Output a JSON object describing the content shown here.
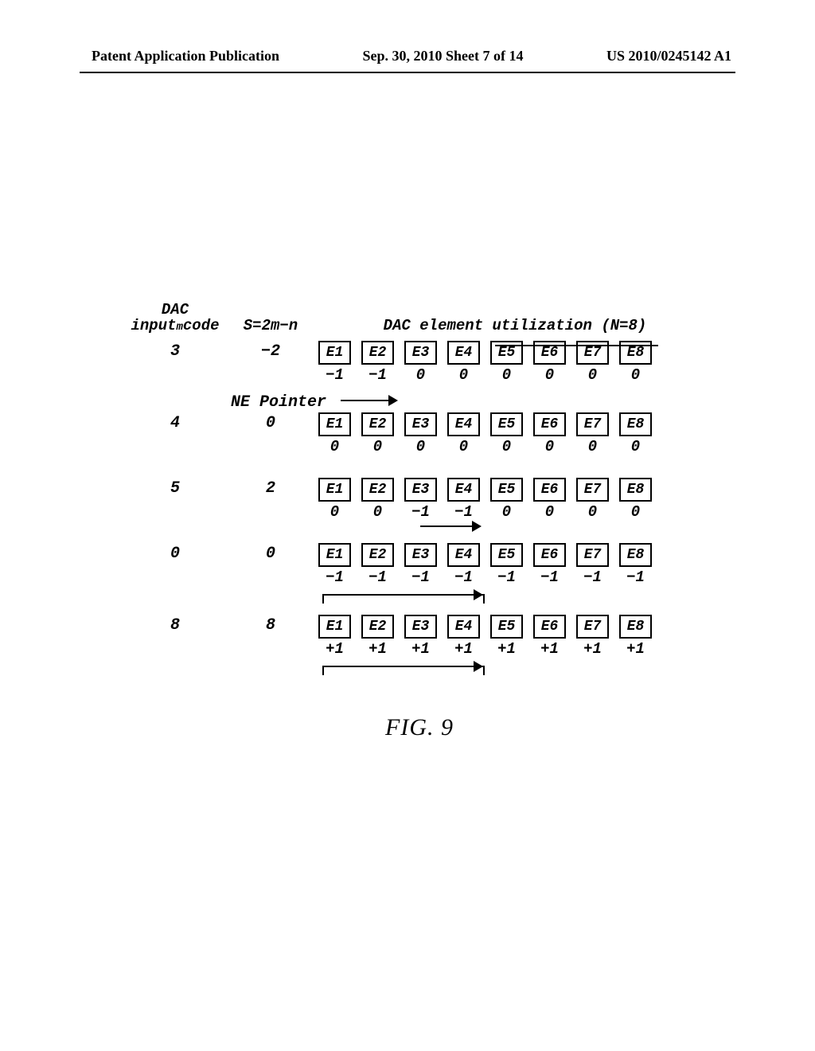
{
  "header": {
    "left": "Patent Application Publication",
    "center": "Sep. 30, 2010  Sheet 7 of 14",
    "right": "US 2010/0245142 A1"
  },
  "columns": {
    "dac_line1": "DAC",
    "dac_line2_prefix": "input",
    "dac_line2_sub": "m",
    "dac_line2_suffix": "code",
    "s": "S=2m−n",
    "util": "DAC element utilization (N=8)"
  },
  "ne_pointer": "NE Pointer",
  "rows": [
    {
      "m": "3",
      "s": "−2",
      "labels": [
        "E1",
        "E2",
        "E3",
        "E4",
        "E5",
        "E6",
        "E7",
        "E8"
      ],
      "values": [
        "−1",
        "−1",
        "0",
        "0",
        "0",
        "0",
        "0",
        "0"
      ]
    },
    {
      "m": "4",
      "s": "0",
      "labels": [
        "E1",
        "E2",
        "E3",
        "E4",
        "E5",
        "E6",
        "E7",
        "E8"
      ],
      "values": [
        "0",
        "0",
        "0",
        "0",
        "0",
        "0",
        "0",
        "0"
      ]
    },
    {
      "m": "5",
      "s": "2",
      "labels": [
        "E1",
        "E2",
        "E3",
        "E4",
        "E5",
        "E6",
        "E7",
        "E8"
      ],
      "values": [
        "0",
        "0",
        "−1",
        "−1",
        "0",
        "0",
        "0",
        "0"
      ]
    },
    {
      "m": "0",
      "s": "0",
      "labels": [
        "E1",
        "E2",
        "E3",
        "E4",
        "E5",
        "E6",
        "E7",
        "E8"
      ],
      "values": [
        "−1",
        "−1",
        "−1",
        "−1",
        "−1",
        "−1",
        "−1",
        "−1"
      ]
    },
    {
      "m": "8",
      "s": "8",
      "labels": [
        "E1",
        "E2",
        "E3",
        "E4",
        "E5",
        "E6",
        "E7",
        "E8"
      ],
      "values": [
        "+1",
        "+1",
        "+1",
        "+1",
        "+1",
        "+1",
        "+1",
        "+1"
      ]
    }
  ],
  "caption": "FIG.  9"
}
